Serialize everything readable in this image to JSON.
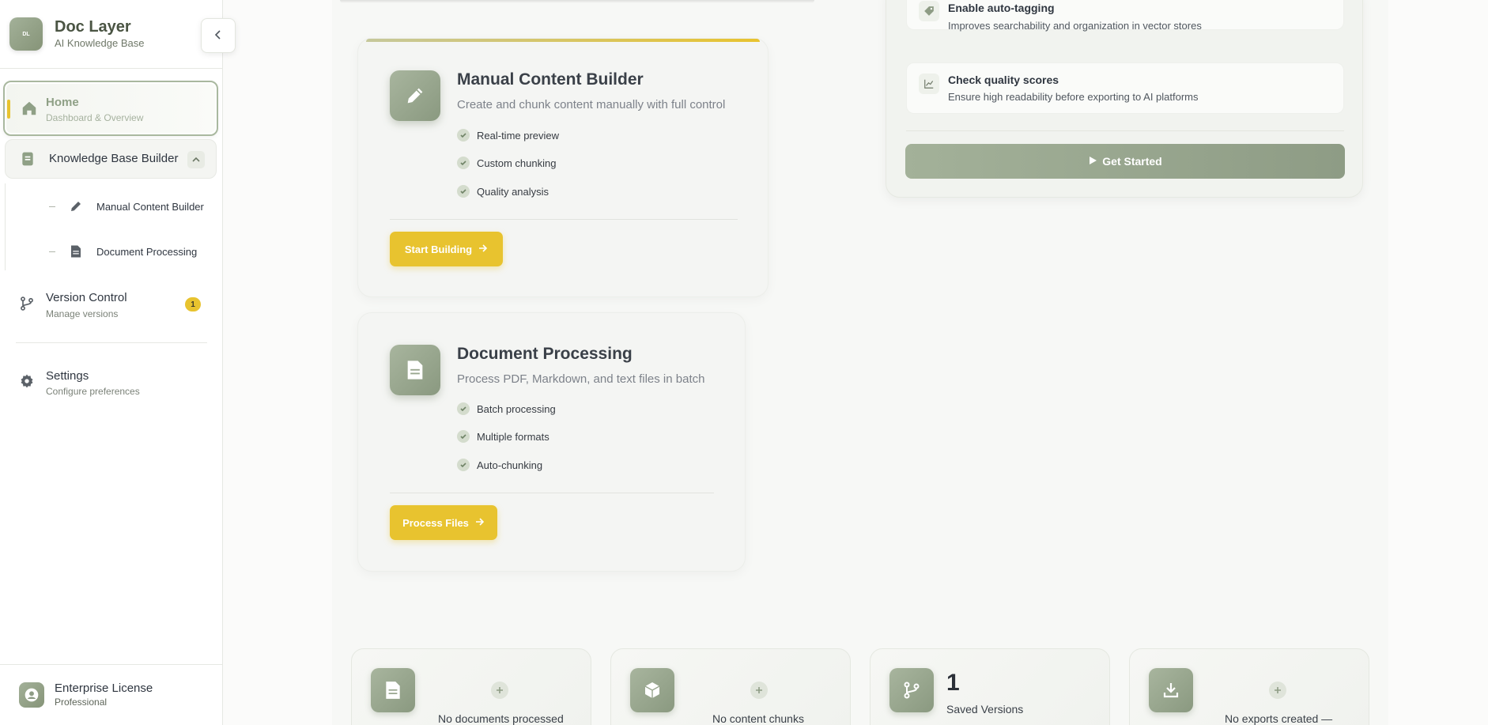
{
  "brand": {
    "logo_text": "DL",
    "title": "Doc Layer",
    "subtitle": "AI Knowledge Base"
  },
  "sidebar": {
    "home": {
      "label": "Home",
      "sub": "Dashboard & Overview"
    },
    "knowledge_base": {
      "label": "Knowledge Base Builder"
    },
    "sub_items": [
      {
        "label": "Manual Content Builder",
        "icon": "pencil-icon"
      },
      {
        "label": "Document Processing",
        "icon": "document-icon"
      }
    ],
    "version_control": {
      "label": "Version Control",
      "sub": "Manage versions",
      "badge": "1"
    },
    "settings": {
      "label": "Settings",
      "sub": "Configure preferences"
    },
    "license": {
      "title": "Enterprise License",
      "tier": "Professional"
    }
  },
  "cards": {
    "manual": {
      "title": "Manual Content Builder",
      "desc": "Create and chunk content manually with full control",
      "features": [
        "Real-time preview",
        "Custom chunking",
        "Quality analysis"
      ],
      "button": "Start Building"
    },
    "document": {
      "title": "Document Processing",
      "desc": "Process PDF, Markdown, and text files in batch",
      "features": [
        "Batch processing",
        "Multiple formats",
        "Auto-chunking"
      ],
      "button": "Process Files"
    }
  },
  "tips": {
    "items": [
      {
        "title": "Enable auto-tagging",
        "desc": "Improves searchability and organization in vector stores"
      },
      {
        "title": "Check quality scores",
        "desc": "Ensure high readability before exporting to AI platforms"
      }
    ],
    "button": "Get Started"
  },
  "stats": {
    "documents": {
      "message": "No documents processed"
    },
    "chunks": {
      "message": "No content chunks"
    },
    "versions": {
      "value": "1",
      "label": "Saved Versions"
    },
    "exports": {
      "message": "No exports created —"
    }
  },
  "colors": {
    "accent": "#e8c32f",
    "sage": "#8e9c85"
  }
}
